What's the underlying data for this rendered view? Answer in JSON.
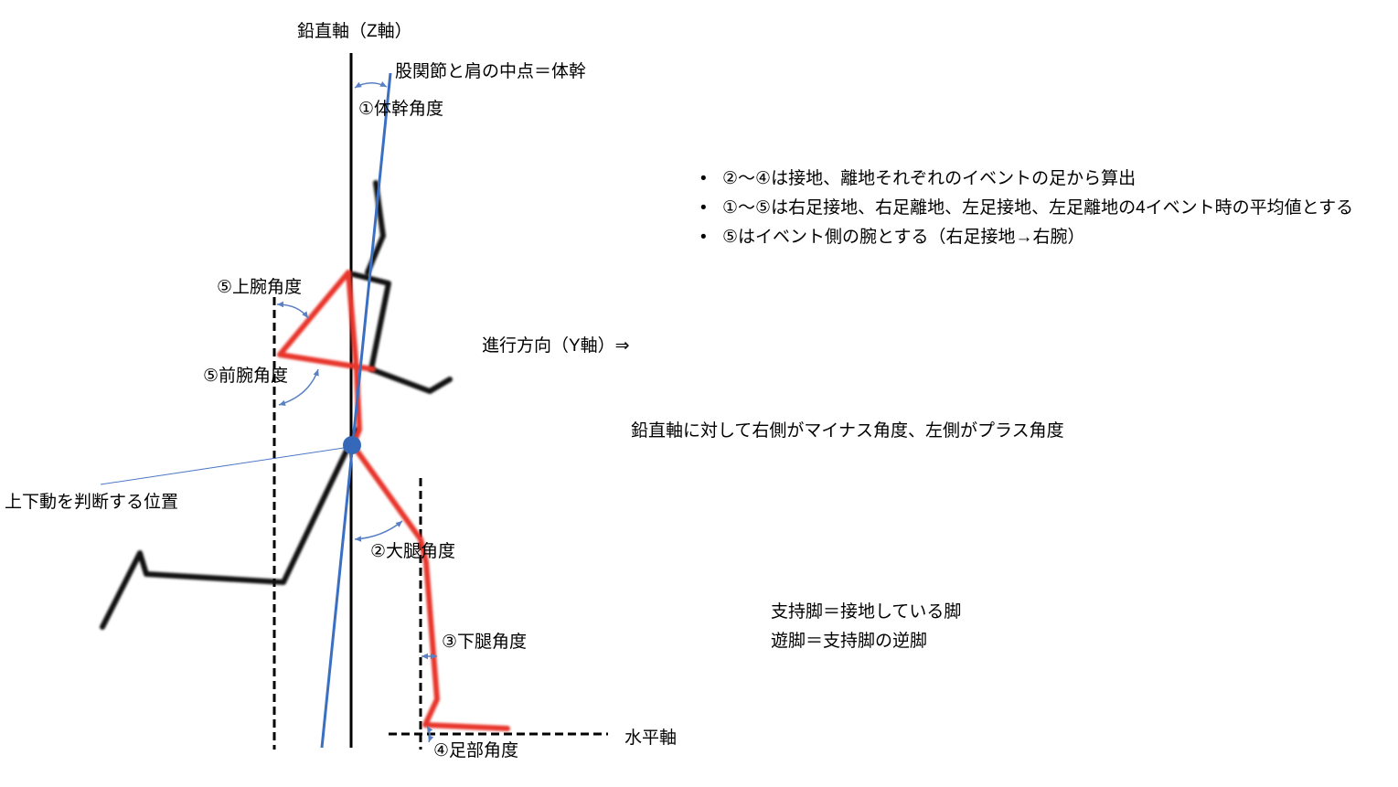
{
  "diagram": {
    "vertical_axis_label": "鉛直軸（Z軸）",
    "trunk_definition": "股関節と肩の中点＝体幹",
    "direction_label": "進行方向（Y軸）⇒",
    "horizontal_axis_label": "水平軸",
    "vertical_motion_point_label": "上下動を判断する位置"
  },
  "angles": {
    "trunk": "①体幹角度",
    "upper_arm": "⑤上腕角度",
    "forearm": "⑤前腕角度",
    "thigh": "②大腿角度",
    "shank": "③下腿角度",
    "foot": "④足部角度"
  },
  "notes": {
    "bullet_glyph": "•",
    "items": [
      "②～④は接地、離地それぞれのイベントの足から算出",
      "①～⑤は右足接地、右足離地、左足接地、左足離地の4イベント時の平均値とする",
      "⑤はイベント側の腕とする（右足接地→右腕）"
    ],
    "sign_convention": "鉛直軸に対して右側がマイナス角度、左側がプラス角度",
    "leg_definitions": [
      "支持脚＝接地している脚",
      "遊脚＝支持脚の逆脚"
    ]
  },
  "colors": {
    "axis": "#000000",
    "far_limbs": "#111111",
    "near_limbs": "#e8362c",
    "trunk_line": "#3a6fc2",
    "marker": "#3568b8",
    "angle_arrows": "#5a80c4",
    "leader_line": "#4d78c6"
  }
}
